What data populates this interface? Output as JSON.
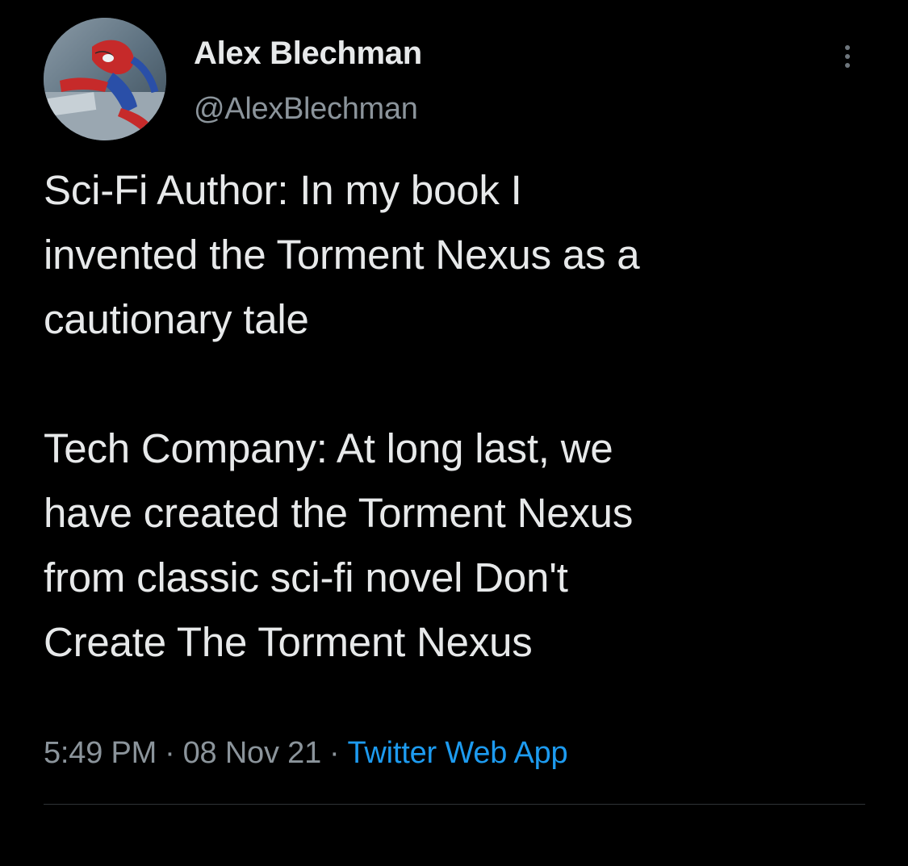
{
  "author": {
    "name": "Alex Blechman",
    "handle": "@AlexBlechman"
  },
  "tweet": {
    "lines_part1": [
      "Sci-Fi Author: In my book I",
      "invented the Torment Nexus as a",
      "cautionary tale"
    ],
    "lines_part2": [
      "Tech Company: At long last, we",
      "have created the Torment Nexus",
      "from classic sci-fi novel Don't",
      "Create The Torment Nexus"
    ]
  },
  "meta": {
    "time": "5:49 PM",
    "separator": "·",
    "date": "08 Nov 21",
    "source": "Twitter Web App"
  },
  "icons": {
    "more": "more-vertical-icon",
    "avatar": "avatar-image"
  },
  "colors": {
    "background": "#000000",
    "text": "#e7e9ea",
    "secondary_text": "#8b949b",
    "link": "#1d9bf0",
    "divider": "#2f3336"
  }
}
